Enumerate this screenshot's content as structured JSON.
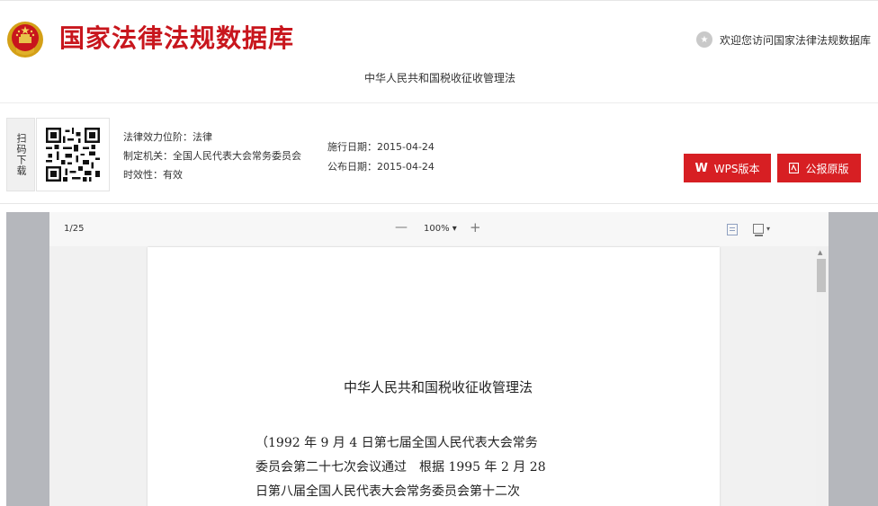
{
  "header": {
    "site_title": "国家法律法规数据库",
    "welcome": "欢迎您访问国家法律法规数据库",
    "doc_heading": "中华人民共和国税收征收管理法"
  },
  "info": {
    "scan_label": "扫码下载",
    "effect_level": "法律效力位阶：法律",
    "authority": "制定机关：全国人民代表大会常务委员会",
    "validity": "时效性：有效",
    "effective_date": "施行日期：2015-04-24",
    "publish_date": "公布日期：2015-04-24",
    "wps_button": "WPS版本",
    "pdf_button": "公报原版"
  },
  "viewer": {
    "page_count": "1/25",
    "zoom_level": "100% ▾",
    "zoom_out": "—",
    "zoom_in": "+"
  },
  "document": {
    "title": "中华人民共和国税收征收管理法",
    "lines": [
      "（1992 年 9 月 4 日第七届全国人民代表大会常务",
      "委员会第二十七次会议通过　根据 1995 年 2 月 28",
      "日第八届全国人民代表大会常务委员会第十二次"
    ]
  },
  "colors": {
    "brand_red": "#c8161d",
    "button_red": "#d71f23"
  },
  "icons": {
    "emblem": "national-emblem-icon",
    "welcome": "star-circle-icon",
    "wps": "wps-logo-icon",
    "pdf": "pdf-icon",
    "qr": "qr-code-icon"
  }
}
